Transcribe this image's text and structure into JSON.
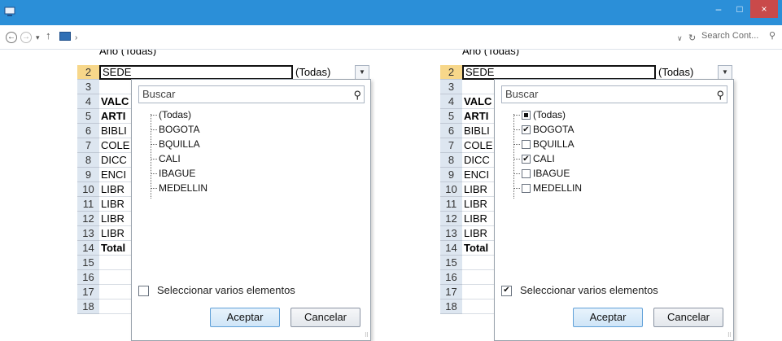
{
  "window": {
    "minimize": "–",
    "maximize": "□",
    "close": "×"
  },
  "addressbar": {
    "back": "←",
    "forward": "→",
    "dropdown": "▾",
    "up": "↑",
    "chevron": "›",
    "addr_dropdown": "∨",
    "refresh": "↻",
    "search_placeholder": "Search Cont...",
    "search_icon": "⚲"
  },
  "sheet": {
    "row_numbers": [
      "2",
      "3",
      "4",
      "5",
      "6",
      "7",
      "8",
      "9",
      "10",
      "11",
      "12",
      "13",
      "14",
      "15",
      "16",
      "17",
      "18"
    ],
    "cells": [
      "SEDE",
      "",
      "VALC",
      "ARTI",
      "BIBLI",
      "COLE",
      "DICC",
      "ENCI",
      "LIBR",
      "LIBR",
      "LIBR",
      "LIBR",
      "Total",
      "",
      "",
      "",
      ""
    ],
    "filter_value": "(Todas)",
    "cropped_top": "Año            (Todas)",
    "dropdown_glyph": "▼"
  },
  "popup": {
    "search_placeholder": "Buscar",
    "search_icon": "⚲",
    "items": [
      "(Todas)",
      "BOGOTA",
      "BQUILLA",
      "CALI",
      "IBAGUE",
      "MEDELLIN"
    ],
    "multi_select_label": "Seleccionar varios elementos",
    "ok_label": "Aceptar",
    "cancel_label": "Cancelar",
    "check_mark": "✔"
  },
  "popup_right": {
    "multi_select_checked": true,
    "item_states": [
      "partial",
      "checked",
      "unchecked",
      "checked",
      "unchecked",
      "unchecked"
    ]
  }
}
